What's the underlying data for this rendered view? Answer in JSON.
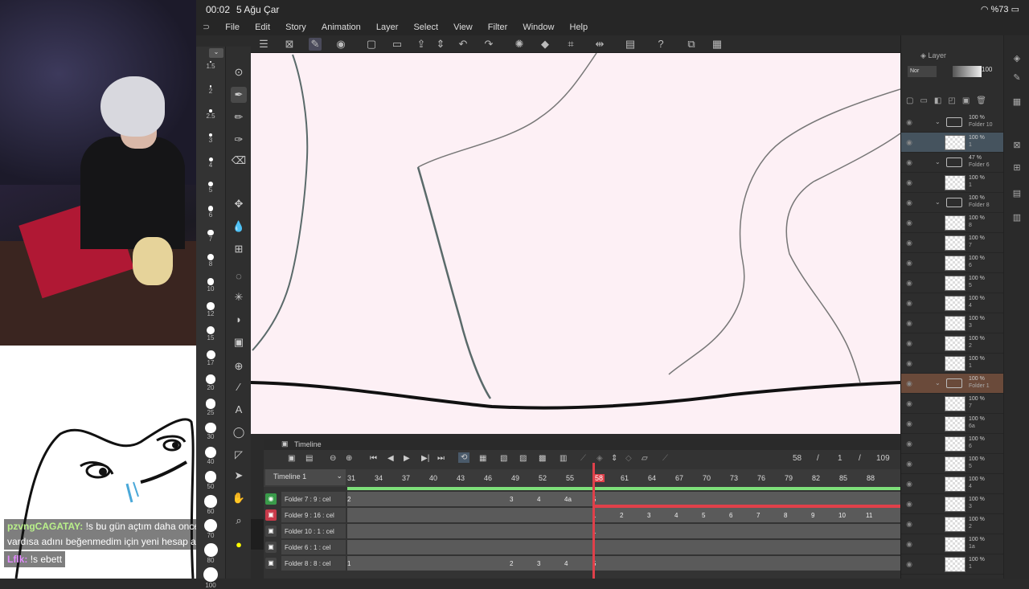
{
  "status": {
    "time": "00:02",
    "date": "5 Ağu Çar",
    "battery": "%73"
  },
  "menu": [
    "File",
    "Edit",
    "Story",
    "Animation",
    "Layer",
    "Select",
    "View",
    "Filter",
    "Window",
    "Help"
  ],
  "brush_sizes": [
    "1.5",
    "2",
    "2.5",
    "3",
    "4",
    "5",
    "6",
    "7",
    "8",
    "10",
    "12",
    "15",
    "17",
    "20",
    "25",
    "30",
    "40",
    "50",
    "60",
    "70",
    "80",
    "100"
  ],
  "chat": [
    {
      "user": "pzvngCAGATAY:",
      "message": "!s bu gün açtım daha once hesabım vardısa adını beğenmedim için yeni hesap açtım"
    },
    {
      "user": "Lflk:",
      "message": "!s ebett"
    }
  ],
  "timeline": {
    "title": "Timeline",
    "name": "Timeline 1",
    "current_frame": "58",
    "separator1": "/",
    "fps": "1",
    "separator2": "/",
    "total_frames": "109",
    "ticks": [
      "31",
      "34",
      "37",
      "40",
      "43",
      "46",
      "49",
      "52",
      "55",
      "58",
      "61",
      "64",
      "67",
      "70",
      "73",
      "76",
      "79",
      "82",
      "85",
      "88"
    ],
    "rows": [
      {
        "label": "Folder 7 : 9 : cel",
        "cels": [
          "2",
          "3",
          "4",
          "4a",
          "5"
        ]
      },
      {
        "label": "Folder 9 : 16 : cel",
        "cels": [
          "1",
          "2",
          "3",
          "4",
          "5",
          "6",
          "7",
          "8",
          "9",
          "10",
          "11"
        ]
      },
      {
        "label": "Folder 10 : 1 : cel",
        "cels": [
          "1"
        ]
      },
      {
        "label": "Folder 6 : 1 : cel",
        "cels": []
      },
      {
        "label": "Folder 8 : 8 : cel",
        "cels": [
          "1",
          "2",
          "3",
          "4",
          "5"
        ]
      }
    ]
  },
  "layers": {
    "tab_label": "Layer",
    "opacity_value": "100",
    "blend_mode": "Nor",
    "items": [
      {
        "pct": "100 %",
        "name": "Folder 10",
        "type": "folder"
      },
      {
        "pct": "100 %",
        "name": "1",
        "type": "layer",
        "selected": true
      },
      {
        "pct": "47 %",
        "name": "Folder 6",
        "type": "folder"
      },
      {
        "pct": "100 %",
        "name": "1",
        "type": "layer"
      },
      {
        "pct": "100 %",
        "name": "Folder 8",
        "type": "folder"
      },
      {
        "pct": "100 %",
        "name": "8",
        "type": "layer"
      },
      {
        "pct": "100 %",
        "name": "7",
        "type": "layer"
      },
      {
        "pct": "100 %",
        "name": "6",
        "type": "layer"
      },
      {
        "pct": "100 %",
        "name": "5",
        "type": "layer"
      },
      {
        "pct": "100 %",
        "name": "4",
        "type": "layer"
      },
      {
        "pct": "100 %",
        "name": "3",
        "type": "layer"
      },
      {
        "pct": "100 %",
        "name": "2",
        "type": "layer"
      },
      {
        "pct": "100 %",
        "name": "1",
        "type": "layer"
      },
      {
        "pct": "100 %",
        "name": "Folder 1",
        "type": "folder",
        "clip": true
      },
      {
        "pct": "100 %",
        "name": "7",
        "type": "layer"
      },
      {
        "pct": "100 %",
        "name": "6a",
        "type": "layer"
      },
      {
        "pct": "100 %",
        "name": "6",
        "type": "layer"
      },
      {
        "pct": "100 %",
        "name": "5",
        "type": "layer"
      },
      {
        "pct": "100 %",
        "name": "4",
        "type": "layer"
      },
      {
        "pct": "100 %",
        "name": "3",
        "type": "layer"
      },
      {
        "pct": "100 %",
        "name": "2",
        "type": "layer"
      },
      {
        "pct": "100 %",
        "name": "1a",
        "type": "layer"
      },
      {
        "pct": "100 %",
        "name": "1",
        "type": "layer"
      }
    ]
  },
  "colors": {
    "canvas": "#fdf0f5",
    "playhead": "#e0404a",
    "track_green": "#7ee07a",
    "folder_clip": "#6a4a3a"
  }
}
